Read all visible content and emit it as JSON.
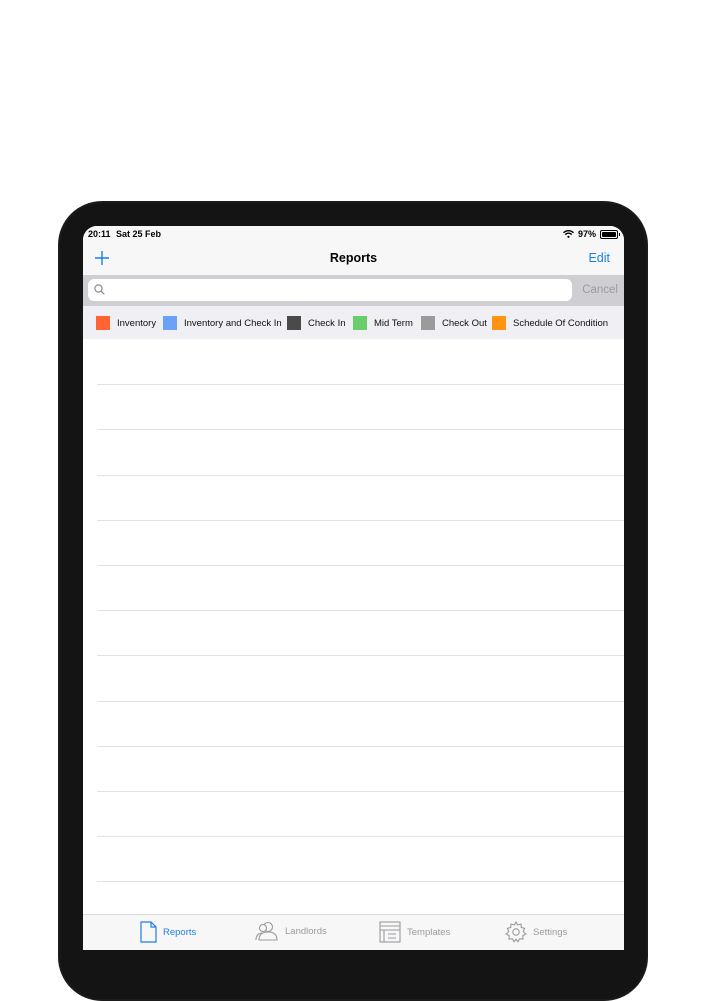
{
  "status_bar": {
    "time": "20:11",
    "date": "Sat 25 Feb",
    "battery": "97%",
    "battery_level": 0.97
  },
  "nav": {
    "add_icon": "plus-icon",
    "title": "Reports",
    "edit_label": "Edit"
  },
  "search": {
    "value": "",
    "placeholder": "",
    "cancel_label": "Cancel"
  },
  "legend": [
    {
      "label": "Inventory",
      "color": "#ff6432"
    },
    {
      "label": "Inventory and Check In",
      "color": "#6ba2f8"
    },
    {
      "label": "Check In",
      "color": "#4a4a4a"
    },
    {
      "label": "Mid Term",
      "color": "#6ccd6c"
    },
    {
      "label": "Check Out",
      "color": "#9b9b9b"
    },
    {
      "label": "Schedule Of Condition",
      "color": "#ff9410"
    }
  ],
  "tabs": [
    {
      "label": "Reports",
      "icon": "document-icon",
      "active": true
    },
    {
      "label": "Landlords",
      "icon": "people-icon",
      "active": false
    },
    {
      "label": "Templates",
      "icon": "template-icon",
      "active": false
    },
    {
      "label": "Settings",
      "icon": "gear-icon",
      "active": false
    }
  ],
  "colors": {
    "accent": "#1b7fe6",
    "inactive_tab": "#9a9a9e"
  }
}
